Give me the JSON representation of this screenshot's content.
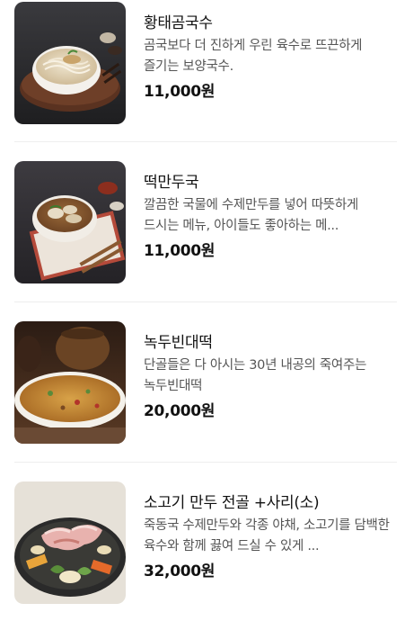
{
  "menu": {
    "items": [
      {
        "name": "황태곰국수",
        "description": "곰국보다 더 진하게 우린 육수로 뜨끈하게 즐기는 보양국수.",
        "price": "11,000원",
        "image_icon": "noodle-soup-bowl-photo"
      },
      {
        "name": "떡만두국",
        "description": "깔끔한 국물에 수제만두를 넣어 따뜻하게 드시는 메뉴, 아이들도 좋아하는 메...",
        "price": "11,000원",
        "image_icon": "dumpling-soup-bowl-photo"
      },
      {
        "name": "녹두빈대떡",
        "description": "단골들은 다 아시는 30년 내공의 죽여주는 녹두빈대떡",
        "price": "20,000원",
        "image_icon": "mung-bean-pancake-photo"
      },
      {
        "name": "소고기 만두 전골 +사리(소)",
        "description": "죽동국 수제만두와 각종 야채, 소고기를 담백한 육수와 함께 끓여 드실 수 있게 ...",
        "price": "32,000원",
        "image_icon": "beef-hotpot-photo"
      }
    ]
  }
}
